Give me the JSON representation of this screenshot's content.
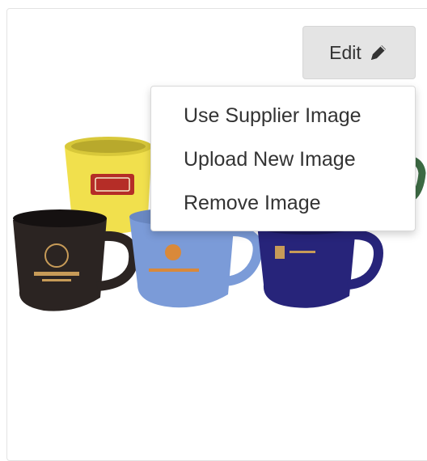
{
  "image_panel": {
    "image_description_icon": "mug-photo",
    "edit_button": {
      "label": "Edit",
      "icon": "pencil-icon"
    },
    "menu": {
      "items": [
        {
          "label": "Use Supplier Image"
        },
        {
          "label": "Upload New Image"
        },
        {
          "label": "Remove Image"
        }
      ]
    }
  }
}
